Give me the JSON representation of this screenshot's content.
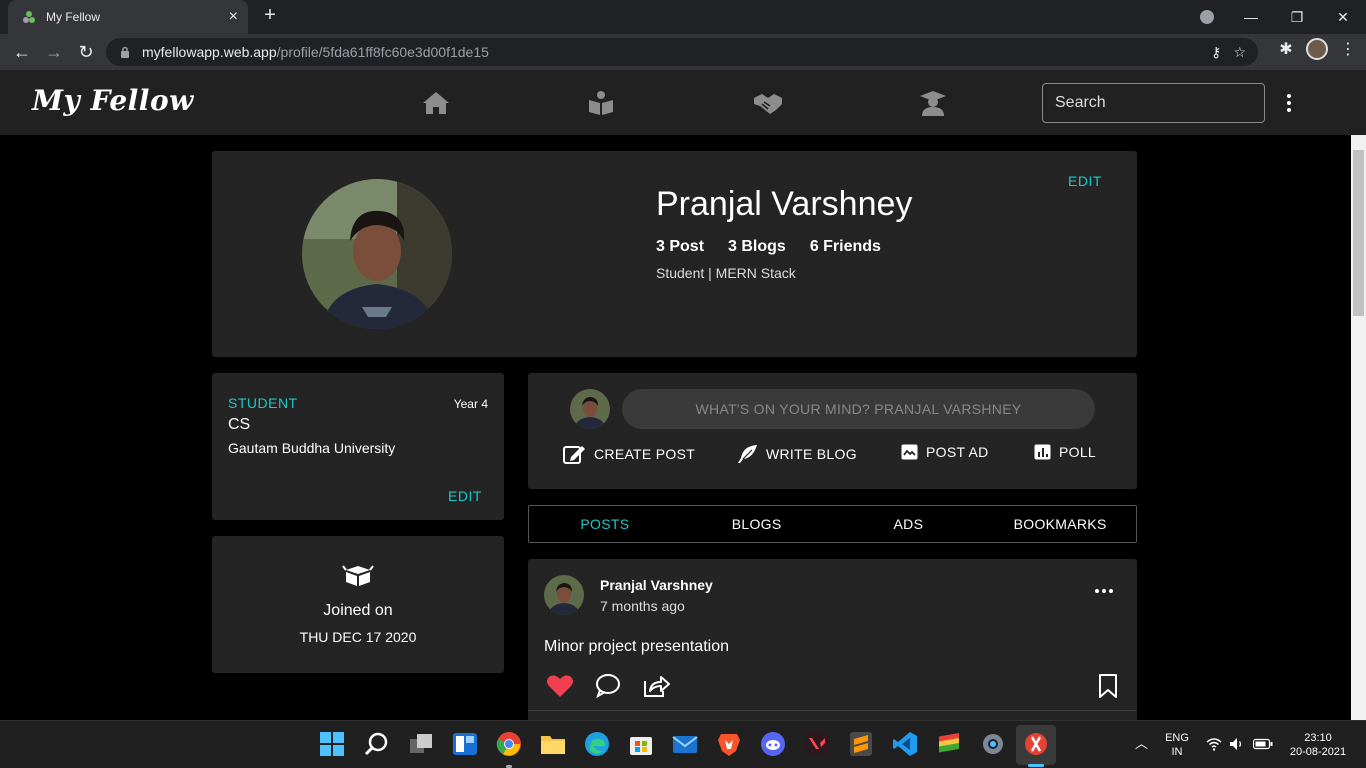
{
  "browser": {
    "tab_title": "My Fellow",
    "tab_close": "×",
    "new_tab": "+",
    "url_host": "myfellowapp.web.app",
    "url_path": "/profile/5fda61ff8fc60e3d00f1de15",
    "window_controls": [
      "—",
      "❐",
      "✕"
    ]
  },
  "app": {
    "brand": "My Fellow",
    "nav_icons": [
      "home-icon",
      "book-reader-icon",
      "handshake-icon",
      "graduate-icon"
    ],
    "search_placeholder": "Search"
  },
  "profile": {
    "name": "Pranjal Varshney",
    "stats": {
      "posts": "3 Post",
      "blogs": "3 Blogs",
      "friends": "6 Friends"
    },
    "bio": "Student | MERN Stack",
    "edit_label": "EDIT"
  },
  "education": {
    "role": "STUDENT",
    "year": "Year 4",
    "branch": "CS",
    "university": "Gautam Buddha University",
    "edit_label": "EDIT"
  },
  "joined": {
    "label": "Joined on",
    "date": "THU DEC 17 2020"
  },
  "composer": {
    "placeholder": "WHAT'S ON YOUR MIND? PRANJAL VARSHNEY",
    "actions": {
      "create_post": "CREATE POST",
      "write_blog": "WRITE BLOG",
      "post_ad": "POST AD",
      "poll": "POLL"
    }
  },
  "profile_tabs": [
    "POSTS",
    "BLOGS",
    "ADS",
    "BOOKMARKS"
  ],
  "active_tab": "POSTS",
  "post": {
    "author": "Pranjal Varshney",
    "time": "7 months ago",
    "text": "Minor project presentation",
    "liked": true
  },
  "taskbar": {
    "language": "ENG",
    "region": "IN",
    "time": "23:10",
    "date": "20-08-2021"
  },
  "colors": {
    "accent": "#1ec8c8",
    "card_bg": "#242424",
    "header_bg": "#212121",
    "like_red": "#f0404f"
  }
}
